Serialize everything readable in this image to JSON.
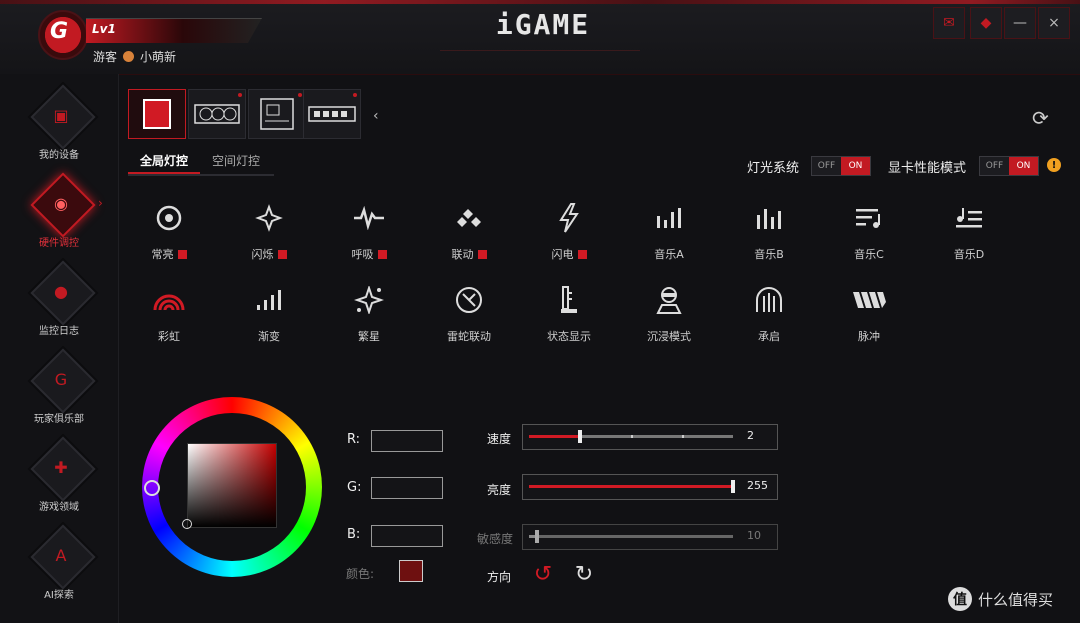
{
  "header": {
    "level": "Lv1",
    "user_role": "游客",
    "username": "小萌新",
    "logo_text": "iGAME"
  },
  "sidebar": {
    "items": [
      {
        "label": "我的设备"
      },
      {
        "label": "硬件调控"
      },
      {
        "label": "监控日志"
      },
      {
        "label": "玩家俱乐部"
      },
      {
        "label": "游戏领域"
      },
      {
        "label": "AI探索"
      }
    ]
  },
  "subtabs": {
    "global": "全局灯控",
    "space": "空间灯控"
  },
  "toggles": {
    "light_system_label": "灯光系统",
    "gpu_mode_label": "显卡性能模式",
    "off": "OFF",
    "on": "ON"
  },
  "modes_row1": [
    "常亮",
    "闪烁",
    "呼吸",
    "联动",
    "闪电",
    "音乐A",
    "音乐B",
    "音乐C",
    "音乐D"
  ],
  "modes_row2": [
    "彩虹",
    "渐变",
    "繁星",
    "雷蛇联动",
    "状态显示",
    "沉浸模式",
    "承启",
    "脉冲"
  ],
  "rgb": {
    "r_label": "R:",
    "g_label": "G:",
    "b_label": "B:",
    "color_label": "颜色:"
  },
  "sliders": {
    "speed": {
      "label": "速度",
      "value": "2",
      "fraction": 0.25
    },
    "brightness": {
      "label": "亮度",
      "value": "255",
      "fraction": 1.0
    },
    "sensitivity": {
      "label": "敏感度",
      "value": "10",
      "fraction": 0.04
    }
  },
  "direction_label": "方向",
  "watermark": {
    "icon": "值",
    "text": "什么值得买"
  },
  "colors": {
    "accent": "#c21a22",
    "swatch": "#6e1010"
  }
}
